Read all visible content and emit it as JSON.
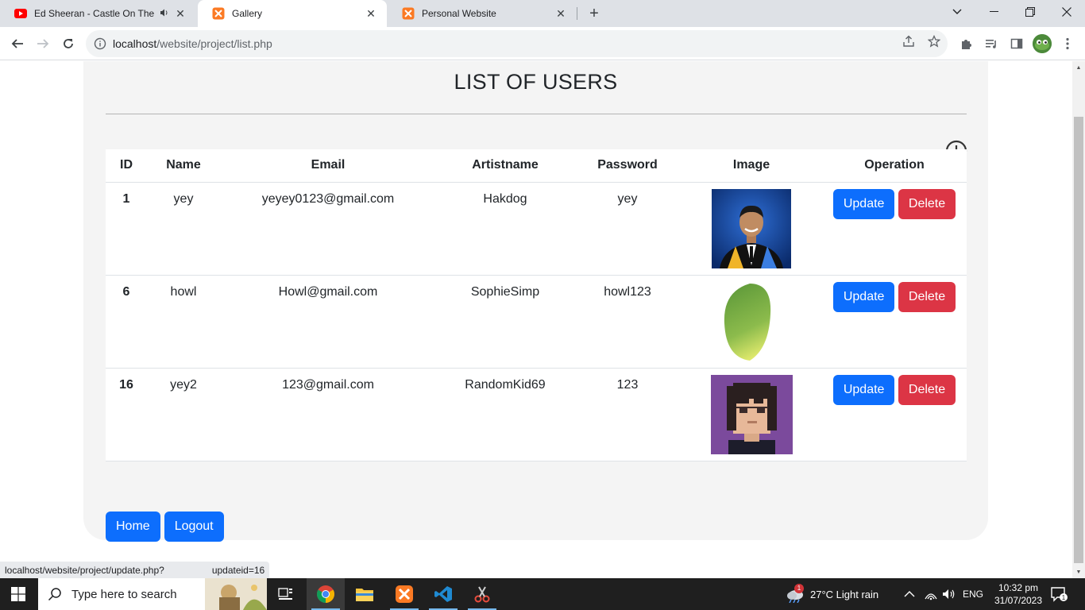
{
  "browser": {
    "tabs": [
      {
        "title": "Ed Sheeran - Castle On The H",
        "icon": "youtube-icon",
        "audio": true,
        "active": false
      },
      {
        "title": "Gallery",
        "icon": "xampp-icon",
        "active": true
      },
      {
        "title": "Personal Website",
        "icon": "xampp-icon",
        "active": false
      }
    ],
    "url_host": "localhost",
    "url_path": "/website/project/list.php",
    "status_url": "localhost/website/project/update.php?",
    "status_url_tail": "updateid=16"
  },
  "page": {
    "title": "LIST OF USERS",
    "add_icon": "plus-circle-icon",
    "columns": [
      "ID",
      "Name",
      "Email",
      "Artistname",
      "Password",
      "Image",
      "Operation"
    ],
    "rows": [
      {
        "id": "1",
        "name": "yey",
        "email": "yeyey0123@gmail.com",
        "artistname": "Hakdog",
        "password": "yey",
        "image": "graduation-portrait"
      },
      {
        "id": "6",
        "name": "howl",
        "email": "Howl@gmail.com",
        "artistname": "SophieSimp",
        "password": "howl123",
        "image": "mango"
      },
      {
        "id": "16",
        "name": "yey2",
        "email": "123@gmail.com",
        "artistname": "RandomKid69",
        "password": "123",
        "image": "pixel-avatar"
      }
    ],
    "update_label": "Update",
    "delete_label": "Delete",
    "home_label": "Home",
    "logout_label": "Logout"
  },
  "taskbar": {
    "search_placeholder": "Type here to search",
    "weather": "27°C  Light rain",
    "weather_badge": "1",
    "language": "ENG",
    "time": "10:32 pm",
    "date": "31/07/2023"
  },
  "colors": {
    "primary": "#0d6efd",
    "danger": "#dc3545",
    "card": "#f4f4f4"
  }
}
